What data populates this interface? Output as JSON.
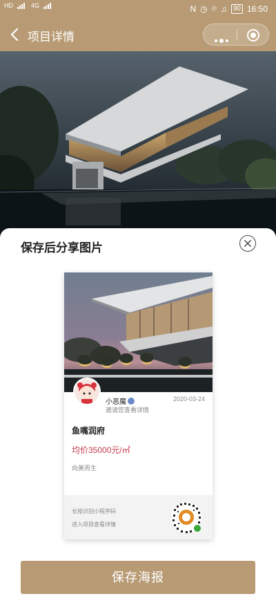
{
  "status_bar": {
    "network_left": [
      "HD",
      "4G",
      "4G"
    ],
    "battery": "90",
    "time": "16:50"
  },
  "nav": {
    "title": "项目详情"
  },
  "share_sheet": {
    "title": "保存后分享图片",
    "poster": {
      "user_name": "小恶魔",
      "date": "2020-03-24",
      "invite_text": "邀请您查看详情",
      "project_name": "鱼嘴润府",
      "price": "均价35000元/㎡",
      "tagline": "向美而生",
      "qr_hint_1": "长按识别小程序码",
      "qr_hint_2": "进入项目查看详情"
    },
    "save_button": "保存海报"
  },
  "colors": {
    "brand": "#b89b74",
    "price": "#c23c4e"
  }
}
